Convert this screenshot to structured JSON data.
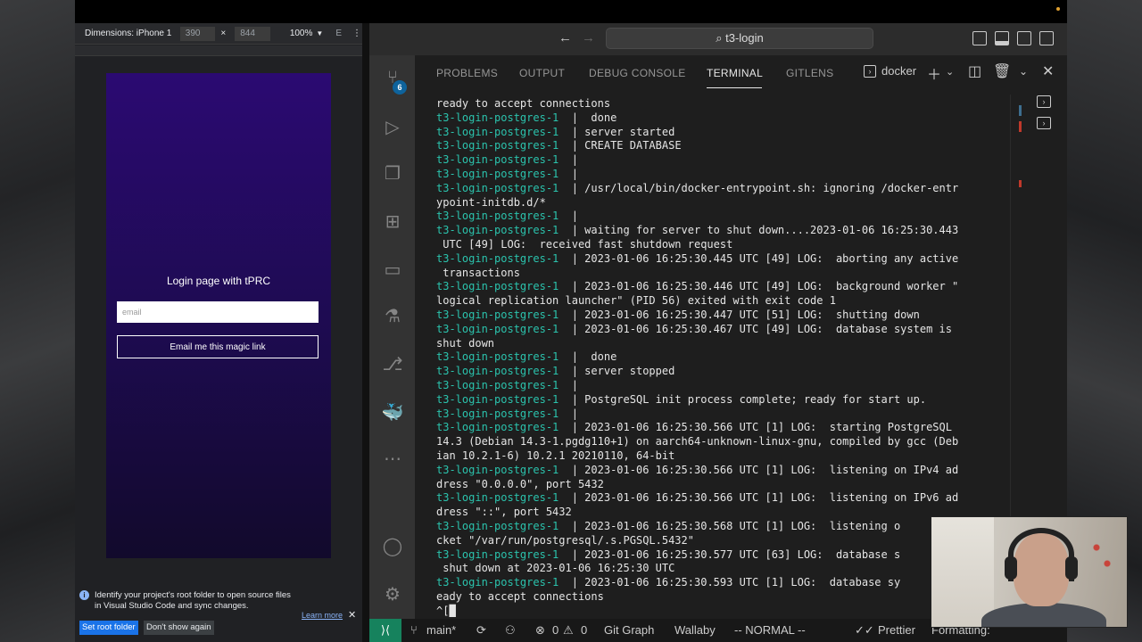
{
  "browser": {
    "dimensions_label": "Dimensions: iPhone 1",
    "width": "390",
    "height": "844",
    "times": "×",
    "zoom": "100%",
    "extra": "E",
    "more": "⋮"
  },
  "app": {
    "title": "Login page with tPRC",
    "email_placeholder": "email",
    "submit_label": "Email me this magic link"
  },
  "notice": {
    "message": "Identify your project's root folder to open source files in Visual Studio Code and sync changes.",
    "learn_more": "Learn more",
    "set_root": "Set root folder",
    "dont_show": "Don't show again"
  },
  "vscode": {
    "search_title": "t3-login",
    "source_control_badge": "6",
    "tabs": [
      "PROBLEMS",
      "OUTPUT",
      "DEBUG CONSOLE",
      "TERMINAL",
      "GITLENS"
    ],
    "active_tab": "TERMINAL",
    "terminal_name": "docker"
  },
  "terminal": {
    "lines": [
      {
        "prefix": "",
        "text": "ready to accept connections"
      },
      {
        "prefix": "t3-login-postgres-1",
        "text": "  |  done"
      },
      {
        "prefix": "t3-login-postgres-1",
        "text": "  | server started"
      },
      {
        "prefix": "t3-login-postgres-1",
        "text": "  | CREATE DATABASE"
      },
      {
        "prefix": "t3-login-postgres-1",
        "text": "  |"
      },
      {
        "prefix": "t3-login-postgres-1",
        "text": "  |"
      },
      {
        "prefix": "t3-login-postgres-1",
        "text": "  | /usr/local/bin/docker-entrypoint.sh: ignoring /docker-entr"
      },
      {
        "prefix": "",
        "text": "ypoint-initdb.d/*"
      },
      {
        "prefix": "t3-login-postgres-1",
        "text": "  |"
      },
      {
        "prefix": "t3-login-postgres-1",
        "text": "  | waiting for server to shut down....2023-01-06 16:25:30.443"
      },
      {
        "prefix": "",
        "text": " UTC [49] LOG:  received fast shutdown request"
      },
      {
        "prefix": "t3-login-postgres-1",
        "text": "  | 2023-01-06 16:25:30.445 UTC [49] LOG:  aborting any active"
      },
      {
        "prefix": "",
        "text": " transactions"
      },
      {
        "prefix": "t3-login-postgres-1",
        "text": "  | 2023-01-06 16:25:30.446 UTC [49] LOG:  background worker \""
      },
      {
        "prefix": "",
        "text": "logical replication launcher\" (PID 56) exited with exit code 1"
      },
      {
        "prefix": "t3-login-postgres-1",
        "text": "  | 2023-01-06 16:25:30.447 UTC [51] LOG:  shutting down"
      },
      {
        "prefix": "t3-login-postgres-1",
        "text": "  | 2023-01-06 16:25:30.467 UTC [49] LOG:  database system is"
      },
      {
        "prefix": "",
        "text": "shut down"
      },
      {
        "prefix": "t3-login-postgres-1",
        "text": "  |  done"
      },
      {
        "prefix": "t3-login-postgres-1",
        "text": "  | server stopped"
      },
      {
        "prefix": "t3-login-postgres-1",
        "text": "  |"
      },
      {
        "prefix": "t3-login-postgres-1",
        "text": "  | PostgreSQL init process complete; ready for start up."
      },
      {
        "prefix": "t3-login-postgres-1",
        "text": "  |"
      },
      {
        "prefix": "t3-login-postgres-1",
        "text": "  | 2023-01-06 16:25:30.566 UTC [1] LOG:  starting PostgreSQL"
      },
      {
        "prefix": "",
        "text": "14.3 (Debian 14.3-1.pgdg110+1) on aarch64-unknown-linux-gnu, compiled by gcc (Deb"
      },
      {
        "prefix": "",
        "text": "ian 10.2.1-6) 10.2.1 20210110, 64-bit"
      },
      {
        "prefix": "t3-login-postgres-1",
        "text": "  | 2023-01-06 16:25:30.566 UTC [1] LOG:  listening on IPv4 ad"
      },
      {
        "prefix": "",
        "text": "dress \"0.0.0.0\", port 5432"
      },
      {
        "prefix": "t3-login-postgres-1",
        "text": "  | 2023-01-06 16:25:30.566 UTC [1] LOG:  listening on IPv6 ad"
      },
      {
        "prefix": "",
        "text": "dress \"::\", port 5432"
      },
      {
        "prefix": "t3-login-postgres-1",
        "text": "  | 2023-01-06 16:25:30.568 UTC [1] LOG:  listening o"
      },
      {
        "prefix": "",
        "text": "cket \"/var/run/postgresql/.s.PGSQL.5432\""
      },
      {
        "prefix": "t3-login-postgres-1",
        "text": "  | 2023-01-06 16:25:30.577 UTC [63] LOG:  database s"
      },
      {
        "prefix": "",
        "text": " shut down at 2023-01-06 16:25:30 UTC"
      },
      {
        "prefix": "t3-login-postgres-1",
        "text": "  | 2023-01-06 16:25:30.593 UTC [1] LOG:  database sy"
      },
      {
        "prefix": "",
        "text": "eady to accept connections"
      },
      {
        "prefix": "",
        "text": "^[█"
      }
    ]
  },
  "statusbar": {
    "branch": "main*",
    "errors": "0",
    "warnings": "0",
    "git_graph": "Git Graph",
    "wallaby": "Wallaby",
    "mode": "-- NORMAL --",
    "prettier": "Prettier",
    "formatting": "Formatting:"
  },
  "colors": {
    "terminal_prefix": "#2bc3ad",
    "accent_blue": "#0e639c",
    "remote_green": "#16825d",
    "phone_gradient_top": "#2b0a72"
  }
}
